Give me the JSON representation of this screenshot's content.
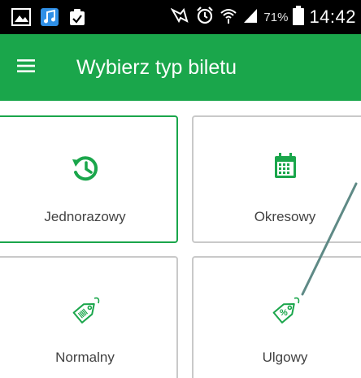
{
  "status_bar": {
    "battery_percent": "71%",
    "time": "14:42",
    "left_icons": [
      "gallery-icon",
      "music-icon",
      "clipboard-check-icon"
    ],
    "right_icons": [
      "nfc-icon",
      "alarm-icon",
      "wifi-icon",
      "signal-icon",
      "battery-icon"
    ]
  },
  "app_bar": {
    "menu_icon": "menu-icon",
    "title": "Wybierz typ biletu",
    "color": "#1aa64b"
  },
  "tickets": [
    {
      "label": "Jednorazowy",
      "icon": "history-icon",
      "selected": true
    },
    {
      "label": "Okresowy",
      "icon": "calendar-icon",
      "selected": false
    },
    {
      "label": "Normalny",
      "icon": "tag-icon",
      "selected": false
    },
    {
      "label": "Ulgowy",
      "icon": "discount-tag-icon",
      "selected": false
    }
  ],
  "colors": {
    "accent": "#1aa64b",
    "card_border": "#c9c9c9",
    "label_text": "#424242"
  }
}
